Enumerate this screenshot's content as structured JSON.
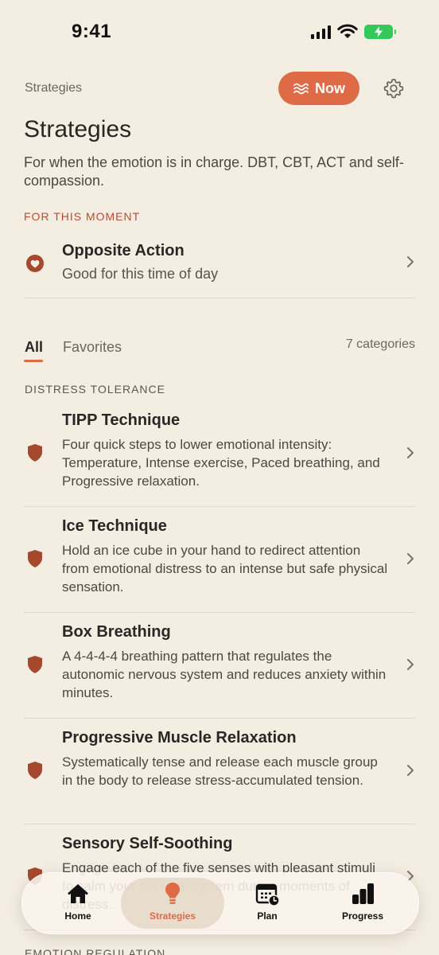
{
  "status_bar": {
    "time": "9:41"
  },
  "header": {
    "breadcrumb": "Strategies",
    "now_label": "Now",
    "title": "Strategies",
    "subtitle": "For when the emotion is in charge. DBT, CBT, ACT and self-compassion."
  },
  "moment": {
    "label": "FOR THIS MOMENT",
    "title": "Opposite Action",
    "subtitle": "Good for this time of day"
  },
  "filters": {
    "all": "All",
    "favorites": "Favorites",
    "count": "7 categories"
  },
  "sections": [
    {
      "label": "DISTRESS TOLERANCE",
      "items": [
        {
          "title": "TIPP Technique",
          "description": "Four quick steps to lower emotional intensity: Temperature, Intense exercise, Paced breathing, and Progressive relaxation."
        },
        {
          "title": "Ice Technique",
          "description": "Hold an ice cube in your hand to redirect attention from emotional distress to an intense but safe physical sensation."
        },
        {
          "title": "Box Breathing",
          "description": "A 4-4-4-4 breathing pattern that regulates the autonomic nervous system and reduces anxiety within minutes."
        },
        {
          "title": "Progressive Muscle Relaxation",
          "description": "Systematically tense and release each muscle group in the body to release stress-accumulated tension."
        },
        {
          "title": "Sensory Self-Soothing",
          "description": "Engage each of the five senses with pleasant stimuli to calm your nervous system during moments of distress."
        }
      ]
    },
    {
      "label": "EMOTION REGULATION"
    }
  ],
  "tab_bar": [
    {
      "label": "Home",
      "icon": "home-icon",
      "active": false
    },
    {
      "label": "Strategies",
      "icon": "lightbulb-icon",
      "active": true
    },
    {
      "label": "Plan",
      "icon": "calendar-clock-icon",
      "active": false
    },
    {
      "label": "Progress",
      "icon": "bar-chart-icon",
      "active": false
    }
  ],
  "colors": {
    "background": "#F4EDE2",
    "accent": "#DE6A46",
    "icon_brown": "#A4492E",
    "section_accent": "#B24F33",
    "text_primary": "#2B2623"
  }
}
